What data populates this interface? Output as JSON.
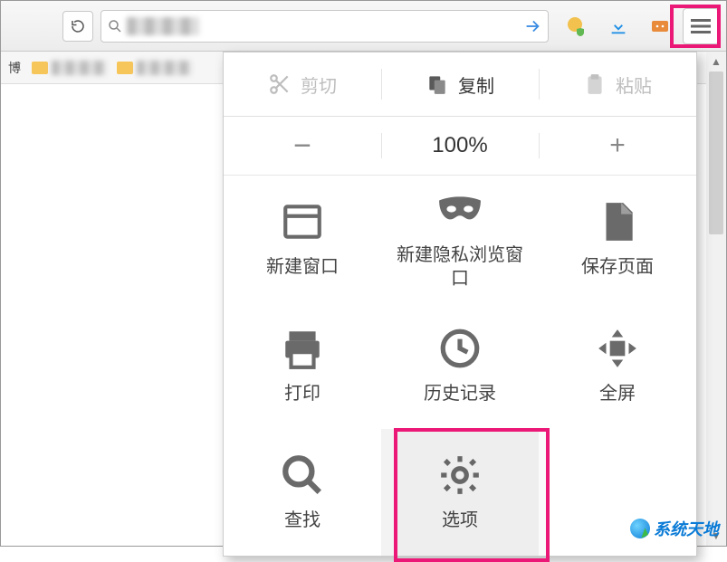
{
  "toolbar": {
    "search_placeholder": "",
    "icons": [
      "globe-shield-icon",
      "download-icon",
      "fox-icon"
    ]
  },
  "bookmarks": {
    "item0": "博"
  },
  "clipboard": {
    "cut": "剪切",
    "copy": "复制",
    "paste": "粘贴"
  },
  "zoom": {
    "minus": "−",
    "level": "100%",
    "plus": "+"
  },
  "menu": {
    "new_window": "新建窗口",
    "private_window": "新建隐私浏览窗口",
    "save_page": "保存页面",
    "print": "打印",
    "history": "历史记录",
    "fullscreen": "全屏",
    "find": "查找",
    "options": "选项"
  },
  "watermark": "系统天地"
}
